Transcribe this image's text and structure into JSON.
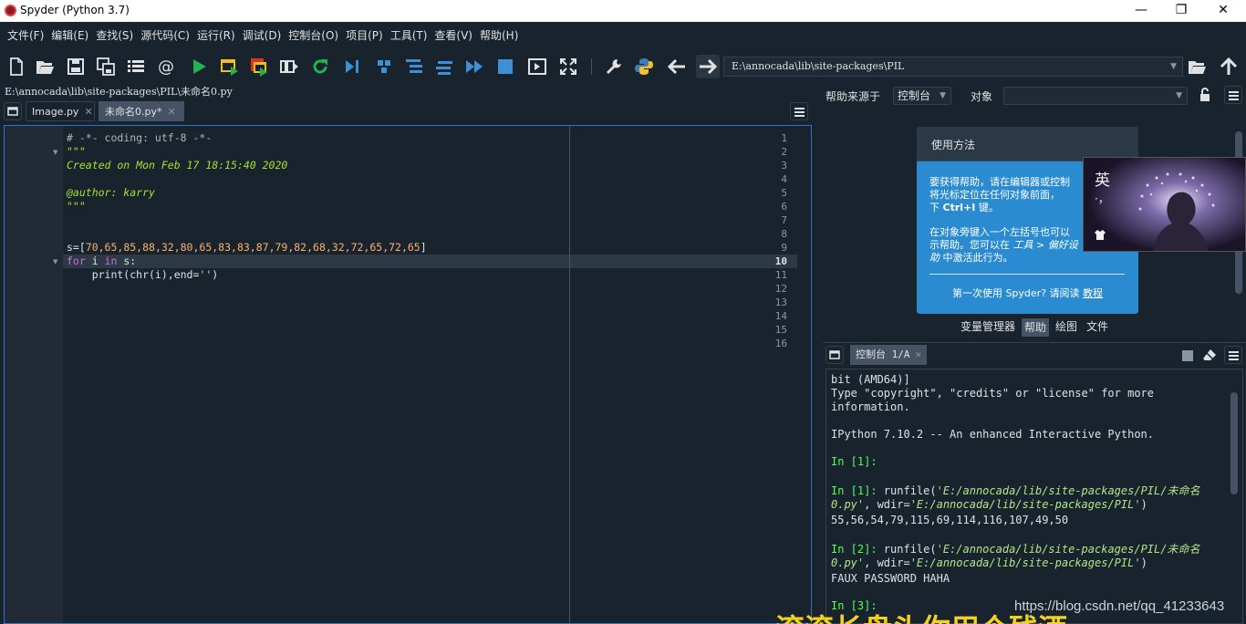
{
  "window": {
    "title": "Spyder (Python 3.7)",
    "min": "—",
    "restore": "❐",
    "close": "✕"
  },
  "menu": [
    "文件(F)",
    "编辑(E)",
    "查找(S)",
    "源代码(C)",
    "运行(R)",
    "调试(D)",
    "控制台(O)",
    "项目(P)",
    "工具(T)",
    "查看(V)",
    "帮助(H)"
  ],
  "toolbar": {
    "path": "E:\\annocada\\lib\\site-packages\\PIL"
  },
  "editor": {
    "path": "E:\\annocada\\lib\\site-packages\\PIL\\未命名0.py",
    "tabs": [
      {
        "label": "Image.py"
      },
      {
        "label": "未命名0.py*"
      }
    ],
    "current_line": 10,
    "line_numbers": [
      "1",
      "2",
      "3",
      "4",
      "5",
      "6",
      "7",
      "8",
      "9",
      "10",
      "11",
      "12",
      "13",
      "14",
      "15",
      "16"
    ],
    "lines": {
      "l1": "# -*- coding: utf-8 -*-",
      "l2": "\"\"\"",
      "l3": "Created on Mon Feb 17 18:15:40 2020",
      "l5": "@author: karry",
      "l6": "\"\"\"",
      "l9_a": "s=[",
      "l9_b": "70,65,85,88,32,80,65,83,83,87,79,82,68,32,72,65,72,65",
      "l9_c": "]",
      "l10_kw1": "for",
      "l10_a": " i ",
      "l10_kw2": "in",
      "l10_b": " s:",
      "l11_a": "    print(chr(i),end=",
      "l11_s": "''",
      "l11_b": ")"
    }
  },
  "help": {
    "source_label": "帮助来源于",
    "source_value": "控制台",
    "object_label": "对象",
    "object_value": "",
    "card_title": "使用方法",
    "p1": "要获得帮助，请在编辑器或控制",
    "p1b": "将光标定位在任何对象前面，",
    "p1c_a": "下 ",
    "p1c_b": "Ctrl+I",
    "p1c_c": " 键。",
    "p2": "在对象旁键入一个左括号也可以",
    "p2b_a": "示帮助。您可以在 ",
    "p2b_b": "工具 > 偏好设",
    "p3_a": "助",
    "p3_b": " 中激活此行为。",
    "footer_a": "第一次使用 Spyder? 请阅读 ",
    "footer_b": "教程",
    "panel_tabs": [
      "变量管理器",
      "帮助",
      "绘图",
      "文件"
    ]
  },
  "overlay": {
    "ime_char": "英",
    "ime_punct": "·，"
  },
  "console": {
    "tab": "控制台 1/A",
    "lines": {
      "c1": "bit (AMD64)]",
      "c2": "Type \"copyright\", \"credits\" or \"license\" for more",
      "c3": "information.",
      "c4": "IPython 7.10.2 -- An enhanced Interactive Python.",
      "p1": "In [1]:",
      "p2": "In [1]:",
      "r1_a": " runfile(",
      "r1_s": "'E:/annocada/lib/site-packages/PIL/未命名",
      "r1_s2": "0.py'",
      "r1_b": ", wdir=",
      "r1_s3": "'E:/annocada/lib/site-packages/PIL'",
      "r1_c": ")",
      "o1": "55,56,54,79,115,69,114,116,107,49,50",
      "p3": "In [2]:",
      "o2": "FAUX PASSWORD HAHA",
      "p4": "In [3]:"
    }
  },
  "watermark": "https://blog.csdn.net/qq_41233643",
  "subtitle": "滚滚长盘头你用个残酒"
}
